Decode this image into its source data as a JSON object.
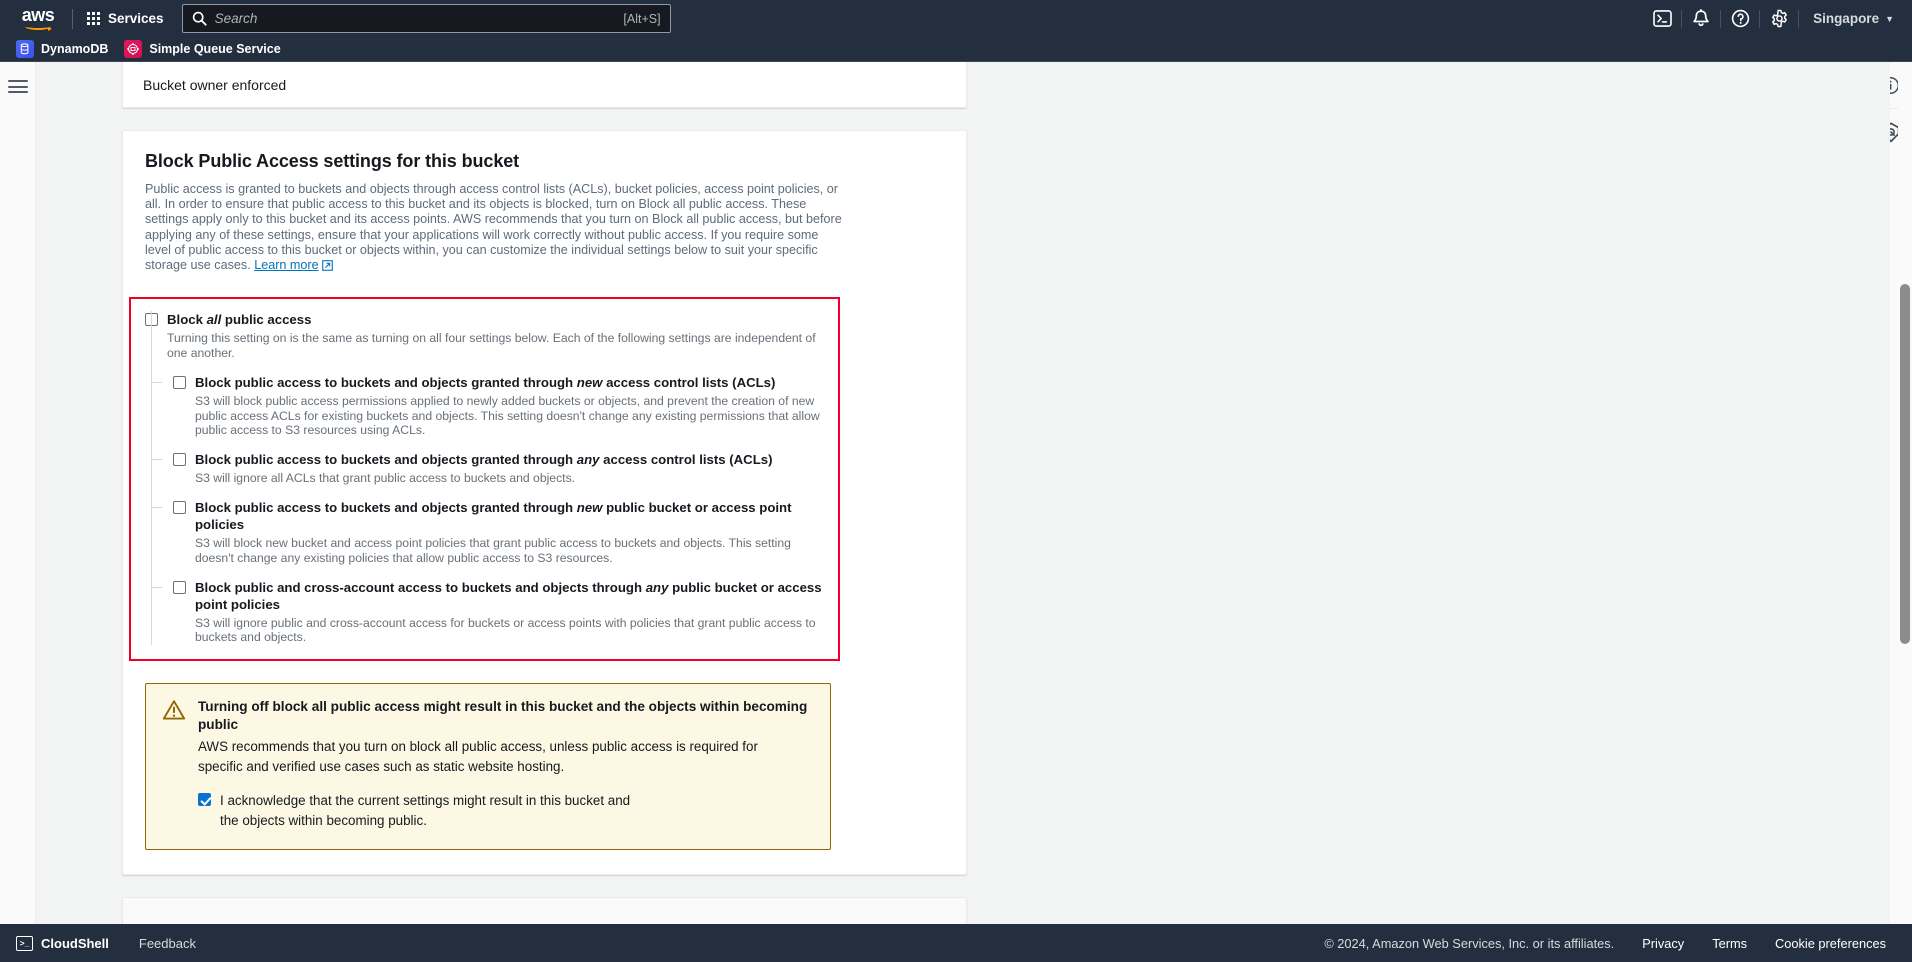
{
  "topnav": {
    "logo_text": "aws",
    "services_label": "Services",
    "search": {
      "placeholder": "Search",
      "value": "",
      "shortcut": "[Alt+S]"
    },
    "icons": [
      {
        "name": "cloudshell-icon",
        "glyph": ">_"
      },
      {
        "name": "notifications-bell-icon",
        "glyph": "␇"
      },
      {
        "name": "help-question-icon",
        "glyph": "?"
      },
      {
        "name": "settings-gear-icon",
        "glyph": "⚙"
      }
    ],
    "region": "Singapore",
    "region_caret": "▼"
  },
  "service_tabs": [
    {
      "label": "DynamoDB",
      "icon": "dynamodb-icon"
    },
    {
      "label": "Simple Queue Service",
      "icon": "sqs-icon"
    }
  ],
  "right_rail": [
    {
      "name": "info-panel-icon"
    },
    {
      "name": "security-shield-icon"
    }
  ],
  "owner_card": {
    "text": "Bucket owner enforced"
  },
  "bpa": {
    "title": "Block Public Access settings for this bucket",
    "description": "Public access is granted to buckets and objects through access control lists (ACLs), bucket policies, access point policies, or all. In order to ensure that public access to this bucket and its objects is blocked, turn on Block all public access. These settings apply only to this bucket and its access points. AWS recommends that you turn on Block all public access, but before applying any of these settings, ensure that your applications will work correctly without public access. If you require some level of public access to this bucket or objects within, you can customize the individual settings below to suit your specific storage use cases.",
    "learn_more": "Learn more",
    "master": {
      "label_pre": "Block ",
      "label_em": "all",
      "label_post": " public access",
      "checked": false,
      "help": "Turning this setting on is the same as turning on all four settings below. Each of the following settings are independent of one another."
    },
    "children": [
      {
        "label_pre": "Block public access to buckets and objects granted through ",
        "label_em": "new",
        "label_post": " access control lists (ACLs)",
        "checked": false,
        "help": "S3 will block public access permissions applied to newly added buckets or objects, and prevent the creation of new public access ACLs for existing buckets and objects. This setting doesn't change any existing permissions that allow public access to S3 resources using ACLs."
      },
      {
        "label_pre": "Block public access to buckets and objects granted through ",
        "label_em": "any",
        "label_post": " access control lists (ACLs)",
        "checked": false,
        "help": "S3 will ignore all ACLs that grant public access to buckets and objects."
      },
      {
        "label_pre": "Block public access to buckets and objects granted through ",
        "label_em": "new",
        "label_post": " public bucket or access point policies",
        "checked": false,
        "help": "S3 will block new bucket and access point policies that grant public access to buckets and objects. This setting doesn't change any existing policies that allow public access to S3 resources."
      },
      {
        "label_pre": "Block public and cross-account access to buckets and objects through ",
        "label_em": "any",
        "label_post": " public bucket or access point policies",
        "checked": false,
        "help": "S3 will ignore public and cross-account access for buckets or access points with policies that grant public access to buckets and objects."
      }
    ]
  },
  "alert": {
    "icon": "warning-triangle-icon",
    "title": "Turning off block all public access might result in this bucket and the objects within becoming public",
    "body": "AWS recommends that you turn on block all public access, unless public access is required for specific and verified use cases such as static website hosting.",
    "acknowledge_text": "I acknowledge that the current settings might result in this bucket and the objects within becoming public.",
    "acknowledge_checked": true
  },
  "footer": {
    "cloudshell": "CloudShell",
    "cloudshell_glyph": ">_",
    "feedback": "Feedback",
    "copyright": "© 2024, Amazon Web Services, Inc. or its affiliates.",
    "links": [
      "Privacy",
      "Terms",
      "Cookie preferences"
    ]
  },
  "colors": {
    "nav_bg": "#232f3e",
    "accent_link": "#0073bb",
    "highlight_border": "#f00028",
    "alert_bg": "#fcf8e3",
    "alert_border": "#906806",
    "checkbox_checked": "#0972d3"
  }
}
